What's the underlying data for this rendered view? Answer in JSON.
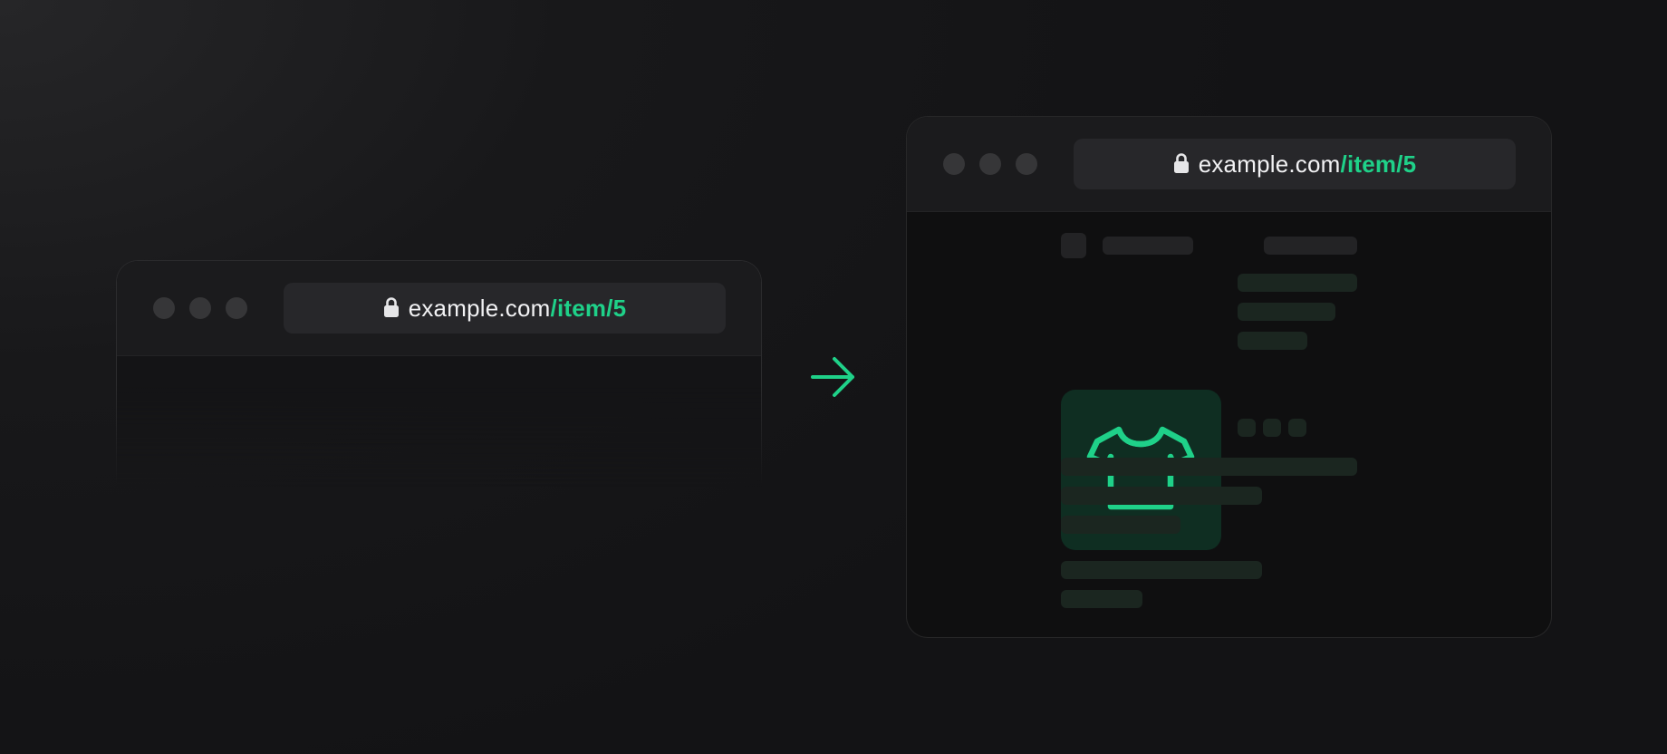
{
  "scene": {
    "accent_color": "#1fd189",
    "transition_icon": "arrow-right-icon"
  },
  "before_window": {
    "url": {
      "host": "example.com",
      "path": "/item/5",
      "secure_icon": "lock-icon"
    },
    "content_state": "blank"
  },
  "after_window": {
    "url": {
      "host": "example.com",
      "path": "/item/5",
      "secure_icon": "lock-icon"
    },
    "content_state": "skeleton",
    "product_image_icon": "t-shirt-icon"
  }
}
